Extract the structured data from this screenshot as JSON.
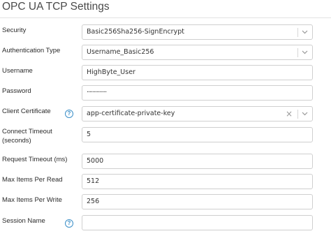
{
  "page": {
    "title": "OPC UA TCP Settings"
  },
  "form": {
    "security": {
      "label": "Security",
      "value": "Basic256Sha256-SignEncrypt"
    },
    "auth_type": {
      "label": "Authentication Type",
      "value": "Username_Basic256"
    },
    "username": {
      "label": "Username",
      "value": "HighByte_User"
    },
    "password": {
      "label": "Password",
      "value": "··············"
    },
    "client_certificate": {
      "label": "Client Certificate",
      "help": "?",
      "value": "app-certificate-private-key",
      "clear": "×"
    },
    "connect_timeout": {
      "label_line1": "Connect Timeout",
      "label_line2": "(seconds)",
      "value": "5"
    },
    "request_timeout": {
      "label": "Request Timeout (ms)",
      "value": "5000"
    },
    "max_items_read": {
      "label": "Max Items Per Read",
      "value": "512"
    },
    "max_items_write": {
      "label": "Max Items Per Write",
      "value": "256"
    },
    "session_name": {
      "label": "Session Name",
      "help": "?",
      "value": ""
    }
  }
}
